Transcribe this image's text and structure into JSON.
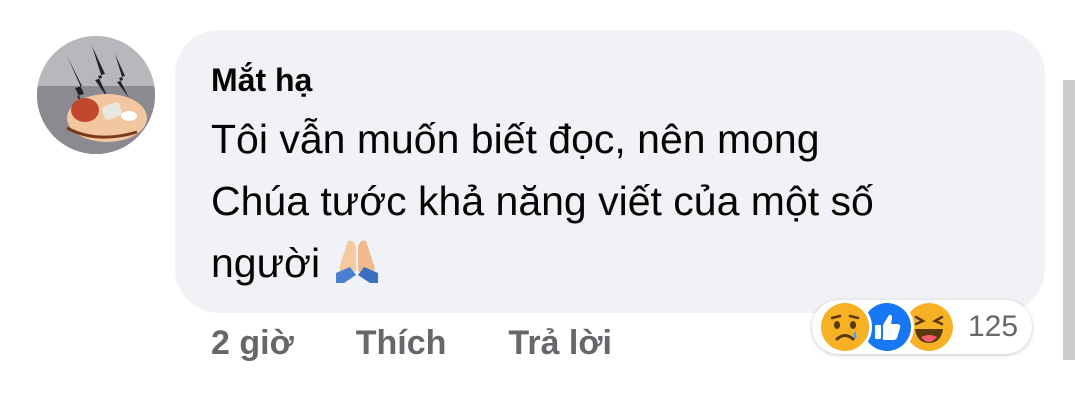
{
  "comment": {
    "author": "Mắt hạ",
    "text_lines": [
      "Tôi vẫn muốn biết đọc, nên mong",
      "Chúa tước khả năng viết của một số",
      "người"
    ],
    "emoji": "folded-hands"
  },
  "actions": {
    "time": "2 giờ",
    "like_label": "Thích",
    "reply_label": "Trả lời"
  },
  "reactions": {
    "icons": [
      "sad",
      "like",
      "haha"
    ],
    "count": "125"
  },
  "colors": {
    "bubble": "#f0f2f5",
    "like_blue": "#1877f2",
    "action_gray": "#65676b",
    "emoji_yellow": "#f7b125"
  }
}
